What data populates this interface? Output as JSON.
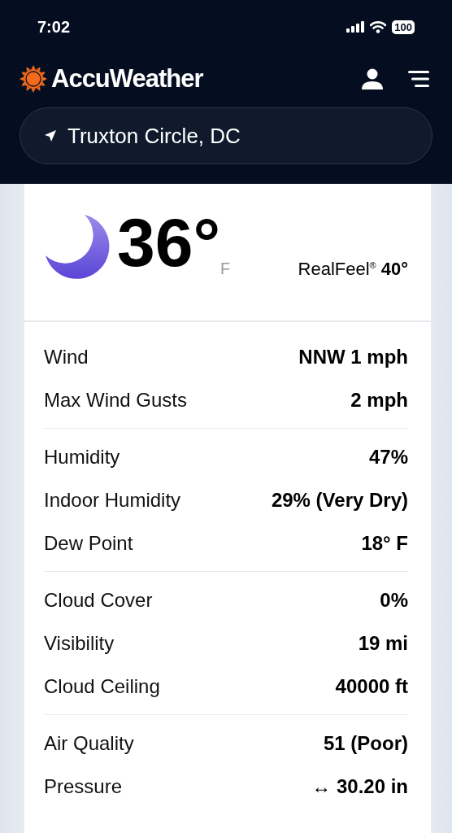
{
  "status_bar": {
    "time": "7:02",
    "battery": "100"
  },
  "header": {
    "logo": "AccuWeather",
    "location": "Truxton Circle, DC"
  },
  "current": {
    "temperature": "36°",
    "unit": "F",
    "realfeel_label": "RealFeel$^{®}$",
    "realfeel_value": "40°"
  },
  "detail_groups": [
    {
      "rows": [
        {
          "label": "Wind",
          "value": "NNW 1 mph"
        },
        {
          "label": "Max Wind Gusts",
          "value": "2 mph"
        }
      ]
    },
    {
      "rows": [
        {
          "label": "Humidity",
          "value": "47%"
        },
        {
          "label": "Indoor Humidity",
          "value": "29% (Very Dry)"
        },
        {
          "label": "Dew Point",
          "value": "18° F"
        }
      ]
    },
    {
      "rows": [
        {
          "label": "Cloud Cover",
          "value": "0%"
        },
        {
          "label": "Visibility",
          "value": "19 mi"
        },
        {
          "label": "Cloud Ceiling",
          "value": "40000 ft"
        }
      ]
    },
    {
      "rows": [
        {
          "label": "Air Quality",
          "value": "51 (Poor)"
        },
        {
          "label": "Pressure",
          "value": "↔ 30.20 in"
        }
      ]
    }
  ]
}
